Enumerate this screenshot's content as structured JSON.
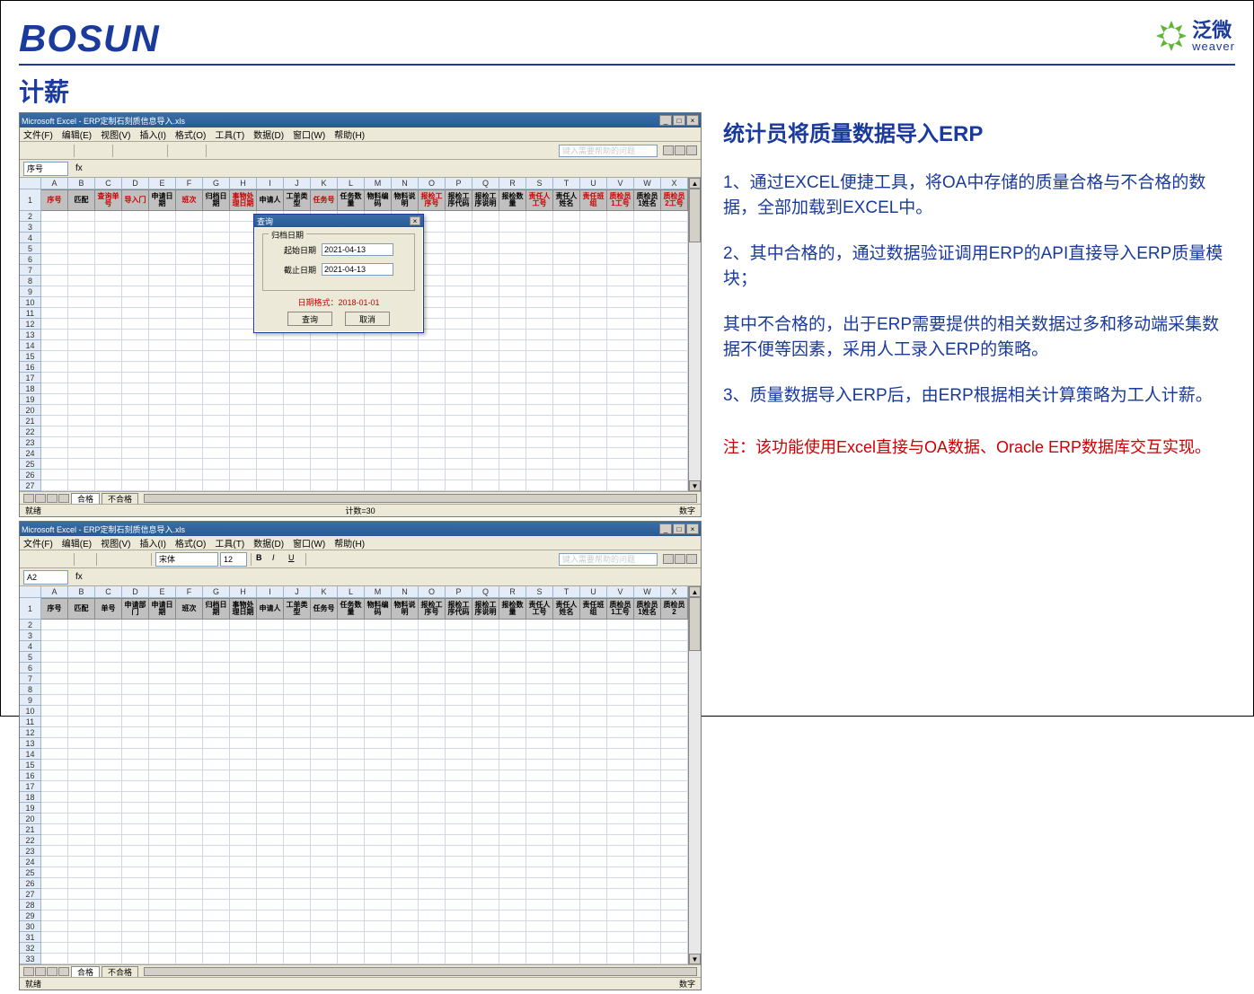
{
  "header": {
    "logo_bosun": "BOSUN",
    "logo_weaver_cn": "泛微",
    "logo_weaver_en": "weaver"
  },
  "page_title": "计薪",
  "excel1": {
    "window_title": "Microsoft Excel - ERP定制石刻质信息导入.xls",
    "menus": [
      "文件(F)",
      "编辑(E)",
      "视图(V)",
      "插入(I)",
      "格式(O)",
      "工具(T)",
      "数据(D)",
      "窗口(W)",
      "帮助(H)"
    ],
    "help_placeholder": "键入需要帮助的问题",
    "cell_ref": "序号",
    "col_letters": [
      "A",
      "B",
      "C",
      "D",
      "E",
      "F",
      "G",
      "H",
      "I",
      "J",
      "K",
      "L",
      "M",
      "N",
      "O",
      "P",
      "Q",
      "R",
      "S",
      "T",
      "U",
      "V",
      "W",
      "X"
    ],
    "row_nums": [
      1,
      2,
      3,
      4,
      5,
      6,
      7,
      8,
      9,
      10,
      11,
      12,
      13,
      14,
      15,
      16,
      17,
      18,
      19,
      20,
      21,
      22,
      23,
      24,
      25,
      26,
      27
    ],
    "headers": [
      {
        "t": "序号",
        "c": "red"
      },
      {
        "t": "匹配",
        "c": ""
      },
      {
        "t": "查询单号",
        "c": "red"
      },
      {
        "t": "导入门",
        "c": "red"
      },
      {
        "t": "申请日期",
        "c": ""
      },
      {
        "t": "班次",
        "c": "red"
      },
      {
        "t": "归档日期",
        "c": ""
      },
      {
        "t": "事物处理日期",
        "c": "red"
      },
      {
        "t": "申请人",
        "c": ""
      },
      {
        "t": "工单类型",
        "c": ""
      },
      {
        "t": "任务号",
        "c": "red"
      },
      {
        "t": "任务数量",
        "c": ""
      },
      {
        "t": "物料编码",
        "c": ""
      },
      {
        "t": "物料说明",
        "c": ""
      },
      {
        "t": "报检工序号",
        "c": "red"
      },
      {
        "t": "报检工序代码",
        "c": ""
      },
      {
        "t": "报检工序说明",
        "c": ""
      },
      {
        "t": "报检数量",
        "c": ""
      },
      {
        "t": "责任人工号",
        "c": "red"
      },
      {
        "t": "责任人姓名",
        "c": ""
      },
      {
        "t": "责任班组",
        "c": "red"
      },
      {
        "t": "质检员1工号",
        "c": "red"
      },
      {
        "t": "质检员1姓名",
        "c": ""
      },
      {
        "t": "质检员2工号",
        "c": "red"
      }
    ],
    "sheet_tabs": [
      "合格",
      "不合格"
    ],
    "status_left": "就绪",
    "status_center": "计数=30",
    "status_right": "数字"
  },
  "dialog": {
    "title": "查询",
    "group_title": "归档日期",
    "start_label": "起始日期",
    "start_value": "2021-04-13",
    "end_label": "截止日期",
    "end_value": "2021-04-13",
    "hint": "日期格式：2018-01-01",
    "btn_ok": "查询",
    "btn_cancel": "取消"
  },
  "excel2": {
    "window_title": "Microsoft Excel - ERP定制石刻质信息导入.xls",
    "menus": [
      "文件(F)",
      "编辑(E)",
      "视图(V)",
      "插入(I)",
      "格式(O)",
      "工具(T)",
      "数据(D)",
      "窗口(W)",
      "帮助(H)"
    ],
    "help_placeholder": "键入需要帮助的问题",
    "font_name": "宋体",
    "font_size": "12",
    "cell_ref": "A2",
    "col_letters": [
      "A",
      "B",
      "C",
      "D",
      "E",
      "F",
      "G",
      "H",
      "I",
      "J",
      "K",
      "L",
      "M",
      "N",
      "O",
      "P",
      "Q",
      "R",
      "S",
      "T",
      "U",
      "V",
      "W",
      "X"
    ],
    "row_nums": [
      1,
      2,
      3,
      4,
      5,
      6,
      7,
      8,
      9,
      10,
      11,
      12,
      13,
      14,
      15,
      16,
      17,
      18,
      19,
      20,
      21,
      22,
      23,
      24,
      25,
      26,
      27,
      28,
      29,
      30,
      31,
      32,
      33
    ],
    "headers": [
      {
        "t": "序号",
        "c": ""
      },
      {
        "t": "匹配",
        "c": ""
      },
      {
        "t": "单号",
        "c": ""
      },
      {
        "t": "申请部门",
        "c": ""
      },
      {
        "t": "申请日期",
        "c": ""
      },
      {
        "t": "班次",
        "c": ""
      },
      {
        "t": "归档日期",
        "c": ""
      },
      {
        "t": "事物处理日期",
        "c": ""
      },
      {
        "t": "申请人",
        "c": ""
      },
      {
        "t": "工单类型",
        "c": ""
      },
      {
        "t": "任务号",
        "c": ""
      },
      {
        "t": "任务数量",
        "c": ""
      },
      {
        "t": "物料编码",
        "c": ""
      },
      {
        "t": "物料说明",
        "c": ""
      },
      {
        "t": "报检工序号",
        "c": ""
      },
      {
        "t": "报检工序代码",
        "c": ""
      },
      {
        "t": "报检工序说明",
        "c": ""
      },
      {
        "t": "报检数量",
        "c": ""
      },
      {
        "t": "责任人工号",
        "c": ""
      },
      {
        "t": "责任人姓名",
        "c": ""
      },
      {
        "t": "责任班组",
        "c": ""
      },
      {
        "t": "质检员1工号",
        "c": ""
      },
      {
        "t": "质检员1姓名",
        "c": ""
      },
      {
        "t": "质检员2",
        "c": ""
      }
    ],
    "sheet_tabs": [
      "合格",
      "不合格"
    ],
    "status_left": "就绪",
    "status_right": "数字"
  },
  "right": {
    "heading": "统计员将质量数据导入ERP",
    "p1": "1、通过EXCEL便捷工具，将OA中存储的质量合格与不合格的数据，全部加载到EXCEL中。",
    "p2": "2、其中合格的，通过数据验证调用ERP的API直接导入ERP质量模块；",
    "p3": "其中不合格的，出于ERP需要提供的相关数据过多和移动端采集数据不便等因素，采用人工录入ERP的策略。",
    "p4": "3、质量数据导入ERP后，由ERP根据相关计算策略为工人计薪。",
    "note": "注：该功能使用Excel直接与OA数据、Oracle ERP数据库交互实现。"
  }
}
